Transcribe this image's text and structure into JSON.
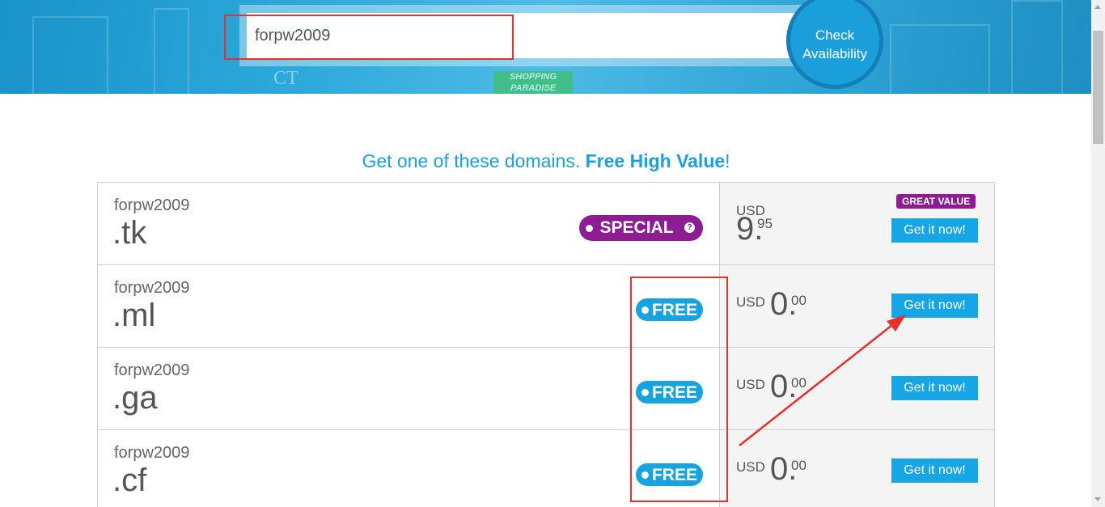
{
  "search": {
    "value": "forpw2009",
    "check_button": {
      "line1": "Check",
      "line2": "Availability"
    },
    "banner_badge": "SHOPPING PARADISE",
    "banner_mark": "CT"
  },
  "heading": {
    "prefix": "Get one of these domains. ",
    "highlight": "Free High Value",
    "suffix": "!"
  },
  "domains": [
    {
      "name": "forpw2009",
      "ext": ".tk",
      "badge": "SPECIAL",
      "badge_type": "special",
      "currency": "USD",
      "price_whole": "9.",
      "price_cents": "95",
      "ribbon": "GREAT VALUE",
      "button": "Get it now!"
    },
    {
      "name": "forpw2009",
      "ext": ".ml",
      "badge": "FREE",
      "badge_type": "free",
      "currency": "USD",
      "price_whole": "0.",
      "price_cents": "00",
      "button": "Get it now!"
    },
    {
      "name": "forpw2009",
      "ext": ".ga",
      "badge": "FREE",
      "badge_type": "free",
      "currency": "USD",
      "price_whole": "0.",
      "price_cents": "00",
      "button": "Get it now!"
    },
    {
      "name": "forpw2009",
      "ext": ".cf",
      "badge": "FREE",
      "badge_type": "free",
      "currency": "USD",
      "price_whole": "0.",
      "price_cents": "00",
      "button": "Get it now!"
    }
  ],
  "icons": {
    "help": "?",
    "special_badge_icon": "question-circle-icon",
    "badge_dot_icon": "dot-icon"
  },
  "colors": {
    "brand_blue": "#1ba1dc",
    "button_blue": "#16a6e6",
    "special_purple": "#8e1c93",
    "annotation_red": "#e8302b"
  }
}
